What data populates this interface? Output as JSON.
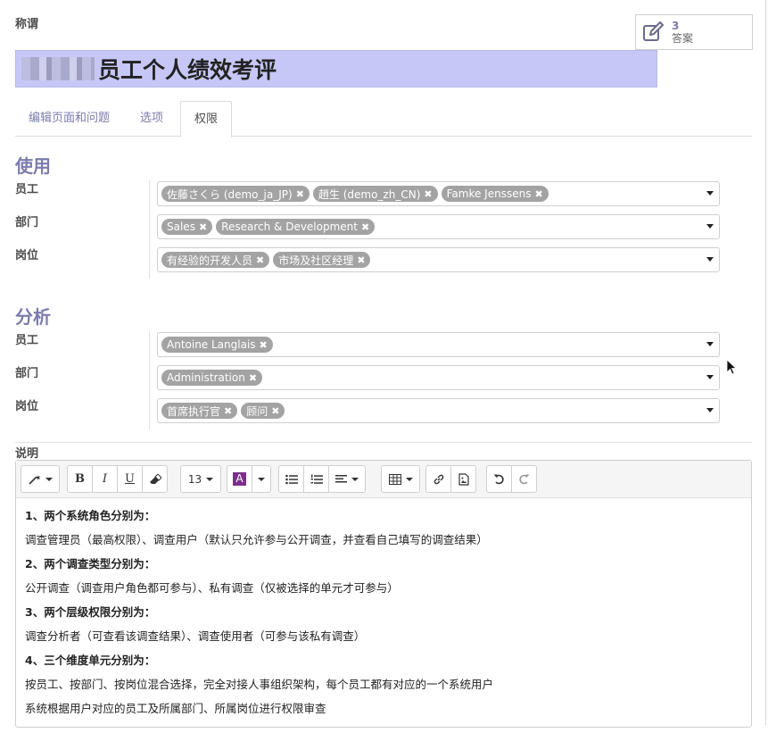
{
  "form": {
    "title_label": "称谓",
    "title_value": "员工个人绩效考评",
    "answers_count": "3",
    "answers_label": "答案"
  },
  "tabs": [
    {
      "label": "编辑页面和问题"
    },
    {
      "label": "选项"
    },
    {
      "label": "权限",
      "active": true
    }
  ],
  "usage": {
    "title": "使用",
    "employee_label": "员工",
    "employees": [
      "佐藤さくら (demo_ja_JP)",
      "趙生 (demo_zh_CN)",
      "Famke Jenssens"
    ],
    "department_label": "部门",
    "departments": [
      "Sales",
      "Research & Development"
    ],
    "job_label": "岗位",
    "jobs": [
      "有经验的开发人员",
      "市场及社区经理"
    ]
  },
  "analysis": {
    "title": "分析",
    "employee_label": "员工",
    "employees": [
      "Antoine Langlais"
    ],
    "department_label": "部门",
    "departments": [
      "Administration"
    ],
    "job_label": "岗位",
    "jobs": [
      "首席执行官",
      "顾问"
    ]
  },
  "description": {
    "label": "说明",
    "font_size": "13",
    "lines": [
      {
        "text": "1、两个系统角色分别为：",
        "bold": true
      },
      {
        "text": "调查管理员（最高权限）、调查用户（默认只允许参与公开调查，并查看自己填写的调查结果）",
        "bold": false
      },
      {
        "text": "2、两个调查类型分别为：",
        "bold": true
      },
      {
        "text": "公开调查（调查用户角色都可参与）、私有调查（仅被选择的单元才可参与）",
        "bold": false
      },
      {
        "text": "3、两个层级权限分别为：",
        "bold": true
      },
      {
        "text": "调查分析者（可查看该调查结果）、调查使用者（可参与该私有调查）",
        "bold": false
      },
      {
        "text": "4、三个维度单元分别为：",
        "bold": true
      },
      {
        "text": "按员工、按部门、按岗位混合选择，完全对接人事组织架构，每个员工都有对应的一个系统用户",
        "bold": false
      },
      {
        "text": "系统根据用户对应的员工及所属部门、所属岗位进行权限审查",
        "bold": false
      }
    ]
  },
  "colors": {
    "accent": "#7c7bad",
    "title_highlight": "#c7c7f7",
    "tag_bg": "#a3a3a3"
  }
}
